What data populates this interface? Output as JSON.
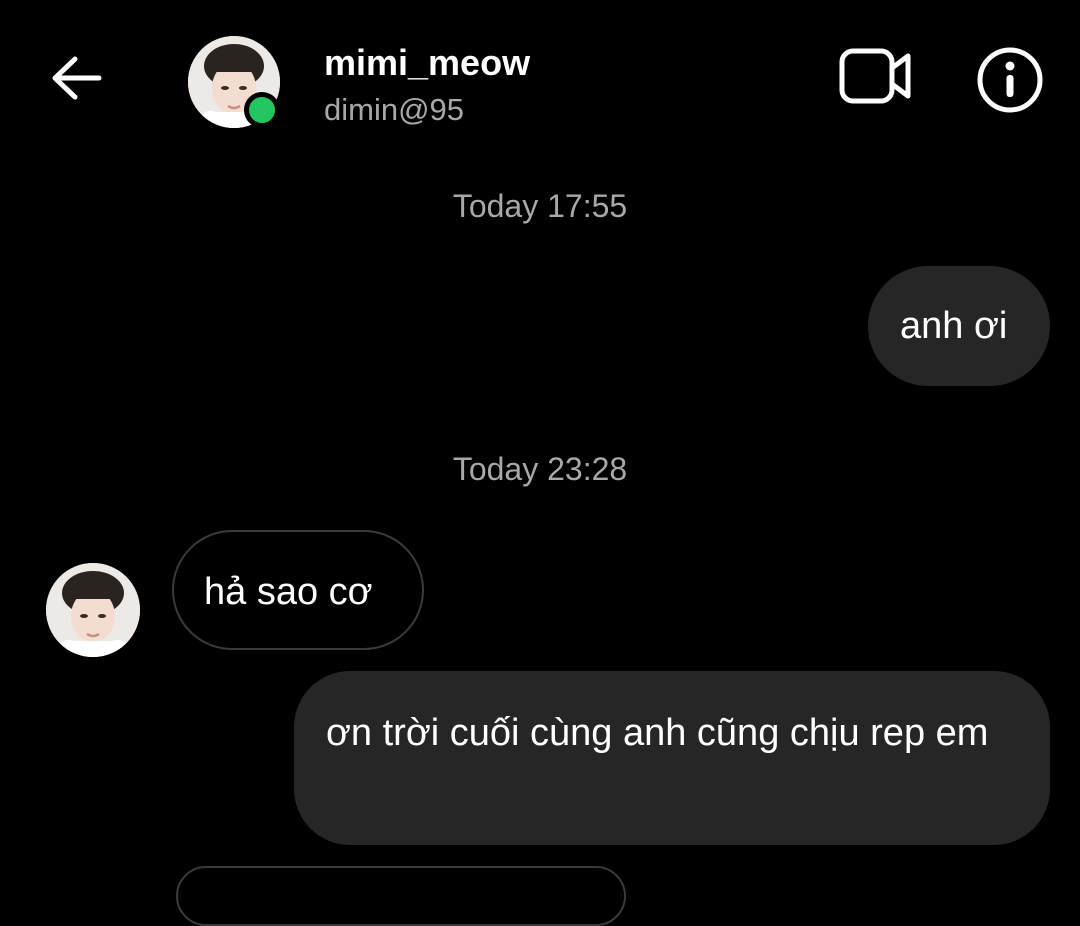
{
  "header": {
    "back_icon": "arrow-left-icon",
    "username": "mimi_meow",
    "handle": "dimin@95",
    "online": true,
    "online_color": "#22c55e",
    "video_icon": "video-camera-icon",
    "info_icon": "info-icon"
  },
  "conversation": {
    "groups": [
      {
        "timestamp": "Today 17:55",
        "messages": [
          {
            "direction": "outgoing",
            "text": "anh ơi"
          }
        ]
      },
      {
        "timestamp": "Today 23:28",
        "messages": [
          {
            "direction": "incoming",
            "text": "hả sao cơ"
          },
          {
            "direction": "outgoing",
            "text": "ơn trời cuối cùng anh cũng chịu rep em"
          }
        ]
      }
    ]
  },
  "colors": {
    "background": "#000000",
    "outgoing_bubble": "#262626",
    "incoming_border": "#3a3a3a",
    "muted_text": "#a8a8a8"
  }
}
